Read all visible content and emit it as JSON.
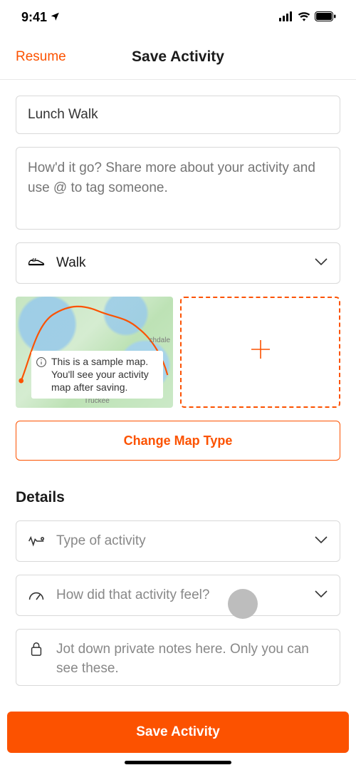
{
  "status": {
    "time": "9:41",
    "signal": "signal-4",
    "wifi": "wifi-on",
    "battery": "battery-full"
  },
  "nav": {
    "left": "Resume",
    "title": "Save Activity"
  },
  "form": {
    "title_value": "Lunch Walk",
    "description_placeholder": "How'd it go? Share more about your activity and use @ to tag someone.",
    "activity_type_label": "Walk"
  },
  "map": {
    "tooltip": "This is a sample map. You'll see your activity map after saving.",
    "change_button": "Change Map Type",
    "label1": "chdale",
    "label2": "Truckee"
  },
  "details": {
    "heading": "Details",
    "type_placeholder": "Type of activity",
    "effort_placeholder": "How did that activity feel?",
    "notes_placeholder": "Jot down private notes here. Only you can see these."
  },
  "footer": {
    "save": "Save Activity"
  },
  "colors": {
    "accent": "#fc5200"
  }
}
